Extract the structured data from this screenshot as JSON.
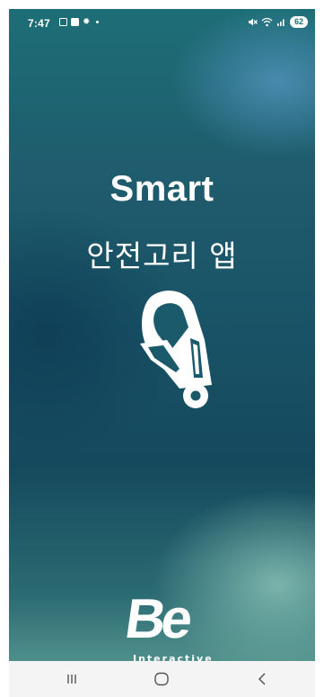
{
  "status_bar": {
    "time": "7:47",
    "battery": "62",
    "left_icons": [
      "gallery-icon",
      "message-icon",
      "settings-icon",
      "notification-dot-icon"
    ],
    "right_icons": [
      "mute-icon",
      "wifi-icon",
      "signal-icon",
      "battery-icon"
    ]
  },
  "splash": {
    "title": "Smart",
    "subtitle": "안전고리 앱",
    "logo_icon": "safety-hook-icon"
  },
  "brand": {
    "name": "Be",
    "tagline": "Interactive"
  },
  "nav_bar": {
    "buttons": [
      "recent-apps-icon",
      "home-icon",
      "back-icon"
    ]
  },
  "colors": {
    "background_top": "#1d6e77",
    "background_mid": "#195266",
    "background_bottom": "#4f8f8a",
    "text": "#ffffff",
    "nav_bar": "#f4f4f4"
  }
}
